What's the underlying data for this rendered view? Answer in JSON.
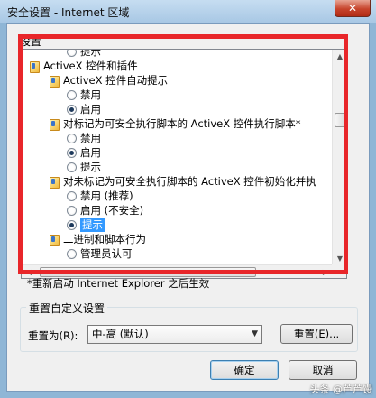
{
  "window": {
    "title": "安全设置 - Internet 区域",
    "close_label": "✕"
  },
  "settings": {
    "group_label": "设置",
    "items": [
      {
        "kind": "radio",
        "label": "提示",
        "level": 3,
        "checked": false
      },
      {
        "kind": "folder",
        "label": "ActiveX 控件和插件",
        "level": 1
      },
      {
        "kind": "folder",
        "label": "ActiveX 控件自动提示",
        "level": 2
      },
      {
        "kind": "radio",
        "label": "禁用",
        "level": 3,
        "checked": false
      },
      {
        "kind": "radio",
        "label": "启用",
        "level": 3,
        "checked": true
      },
      {
        "kind": "folder",
        "label": "对标记为可安全执行脚本的 ActiveX 控件执行脚本*",
        "level": 2
      },
      {
        "kind": "radio",
        "label": "禁用",
        "level": 3,
        "checked": false
      },
      {
        "kind": "radio",
        "label": "启用",
        "level": 3,
        "checked": true
      },
      {
        "kind": "radio",
        "label": "提示",
        "level": 3,
        "checked": false
      },
      {
        "kind": "folder",
        "label": "对未标记为可安全执行脚本的 ActiveX 控件初始化并执",
        "level": 2
      },
      {
        "kind": "radio",
        "label": "禁用 (推荐)",
        "level": 3,
        "checked": false
      },
      {
        "kind": "radio",
        "label": "启用 (不安全)",
        "level": 3,
        "checked": false
      },
      {
        "kind": "radio",
        "label": "提示",
        "level": 3,
        "checked": true,
        "selected": true
      },
      {
        "kind": "folder",
        "label": "二进制和脚本行为",
        "level": 2
      },
      {
        "kind": "radio",
        "label": "管理员认可",
        "level": 3,
        "checked": false
      }
    ],
    "note": "*重新启动 Internet Explorer 之后生效"
  },
  "reset": {
    "group_label": "重置自定义设置",
    "reset_to_label": "重置为(R):",
    "selected_level": "中-高 (默认)",
    "reset_button": "重置(E)..."
  },
  "buttons": {
    "ok": "确定",
    "cancel": "取消"
  },
  "watermark": "头条 @芦芦馒"
}
